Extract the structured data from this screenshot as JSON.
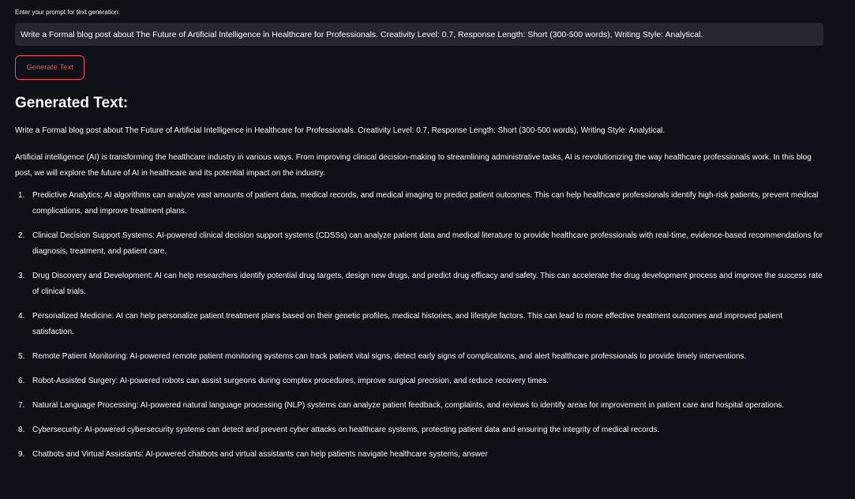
{
  "input": {
    "label": "Enter your prompt for text generation:",
    "value": "Write a Formal blog post about The Future of Artificial Intelligence in Healthcare for Professionals. Creativity Level: 0.7, Response Length: Short (300-500 words), Writing Style: Analytical."
  },
  "button": {
    "label": "Generate Text"
  },
  "output": {
    "title": "Generated Text:",
    "echo": "Write a Formal blog post about The Future of Artificial Intelligence in Healthcare for Professionals. Creativity Level: 0.7, Response Length: Short (300-500 words), Writing Style: Analytical.",
    "intro": "Artificial intelligence (AI) is transforming the healthcare industry in various ways. From improving clinical decision-making to streamlining administrative tasks, AI is revolutionizing the way healthcare professionals work. In this blog post, we will explore the future of AI in healthcare and its potential impact on the industry.",
    "items": [
      {
        "num": "1.",
        "text": "Predictive Analytics: AI algorithms can analyze vast amounts of patient data, medical records, and medical imaging to predict patient outcomes. This can help healthcare professionals identify high-risk patients, prevent medical complications, and improve treatment plans."
      },
      {
        "num": "2.",
        "text": "Clinical Decision Support Systems: AI-powered clinical decision support systems (CDSSs) can analyze patient data and medical literature to provide healthcare professionals with real-time, evidence-based recommendations for diagnosis, treatment, and patient care."
      },
      {
        "num": "3.",
        "text": "Drug Discovery and Development: AI can help researchers identify potential drug targets, design new drugs, and predict drug efficacy and safety. This can accelerate the drug development process and improve the success rate of clinical trials."
      },
      {
        "num": "4.",
        "text": "Personalized Medicine: AI can help personalize patient treatment plans based on their genetic profiles, medical histories, and lifestyle factors. This can lead to more effective treatment outcomes and improved patient satisfaction."
      },
      {
        "num": "5.",
        "text": "Remote Patient Monitoring: AI-powered remote patient monitoring systems can track patient vital signs, detect early signs of complications, and alert healthcare professionals to provide timely interventions."
      },
      {
        "num": "6.",
        "text": "Robot-Assisted Surgery: AI-powered robots can assist surgeons during complex procedures, improve surgical precision, and reduce recovery times."
      },
      {
        "num": "7.",
        "text": "Natural Language Processing: AI-powered natural language processing (NLP) systems can analyze patient feedback, complaints, and reviews to identify areas for improvement in patient care and hospital operations."
      },
      {
        "num": "8.",
        "text": "Cybersecurity: AI-powered cybersecurity systems can detect and prevent cyber attacks on healthcare systems, protecting patient data and ensuring the integrity of medical records."
      },
      {
        "num": "9.",
        "text": "Chatbots and Virtual Assistants: AI-powered chatbots and virtual assistants can help patients navigate healthcare systems, answer"
      }
    ]
  },
  "colors": {
    "background": "#0e1117",
    "input_background": "#262730",
    "accent": "#ff4b4b",
    "text": "#fafafa"
  }
}
